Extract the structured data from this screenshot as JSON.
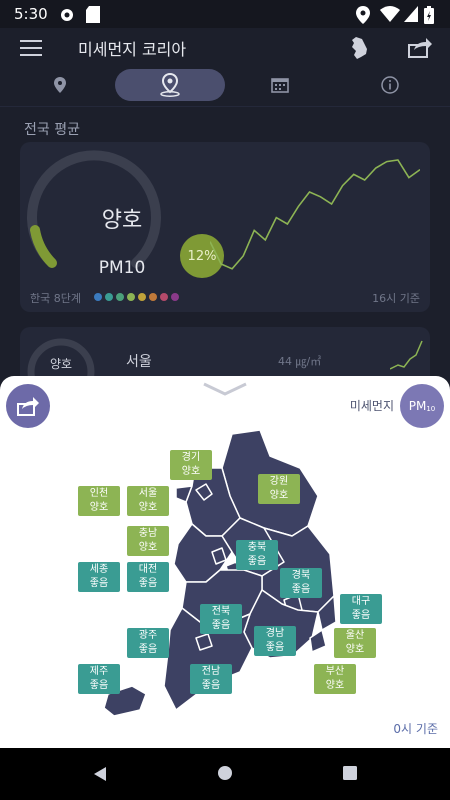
{
  "status_bar": {
    "time": "5:30"
  },
  "app_bar": {
    "title": "미세먼지 코리아"
  },
  "tabs": [
    "location",
    "map",
    "calendar",
    "info"
  ],
  "content": {
    "section_title": "전국 평균",
    "national_card": {
      "grade": "양호",
      "pollutant": "PM10",
      "percent": "12%",
      "scale_label": "한국 8단계",
      "scale_colors": [
        "#3b7bbf",
        "#3a9c93",
        "#4ba07a",
        "#8db454",
        "#c0a23a",
        "#c07a3a",
        "#b44a6a",
        "#8a3a8a"
      ],
      "time_basis": "16시 기준",
      "trend": [
        48,
        20,
        14,
        30,
        62,
        50,
        78,
        70,
        92,
        110,
        104,
        95,
        118,
        132,
        125,
        140,
        148,
        150,
        128,
        138
      ]
    },
    "city_card": {
      "gauge_grade": "양호",
      "city": "서울",
      "value": "44 ㎍/㎥"
    }
  },
  "sheet": {
    "pollutant_selector_label": "미세먼지",
    "pm_button": {
      "main": "PM",
      "sub": "10"
    },
    "time_basis": "0시 기준",
    "regions": [
      {
        "name": "경기",
        "grade": "양호",
        "level": "good"
      },
      {
        "name": "강원",
        "grade": "양호",
        "level": "good"
      },
      {
        "name": "인천",
        "grade": "양호",
        "level": "good"
      },
      {
        "name": "서울",
        "grade": "양호",
        "level": "good"
      },
      {
        "name": "충남",
        "grade": "양호",
        "level": "good"
      },
      {
        "name": "충북",
        "grade": "좋음",
        "level": "verygood"
      },
      {
        "name": "세종",
        "grade": "좋음",
        "level": "verygood"
      },
      {
        "name": "대전",
        "grade": "좋음",
        "level": "verygood"
      },
      {
        "name": "경북",
        "grade": "좋음",
        "level": "verygood"
      },
      {
        "name": "대구",
        "grade": "좋음",
        "level": "verygood"
      },
      {
        "name": "전북",
        "grade": "좋음",
        "level": "verygood"
      },
      {
        "name": "경남",
        "grade": "좋음",
        "level": "verygood"
      },
      {
        "name": "울산",
        "grade": "양호",
        "level": "good"
      },
      {
        "name": "광주",
        "grade": "좋음",
        "level": "verygood"
      },
      {
        "name": "부산",
        "grade": "양호",
        "level": "good"
      },
      {
        "name": "제주",
        "grade": "좋음",
        "level": "verygood"
      },
      {
        "name": "전남",
        "grade": "좋음",
        "level": "verygood"
      }
    ]
  },
  "colors": {
    "accent": "#7c78b4",
    "good": "#8db454",
    "verygood": "#3a9c93",
    "map_fill": "#3d4163"
  }
}
